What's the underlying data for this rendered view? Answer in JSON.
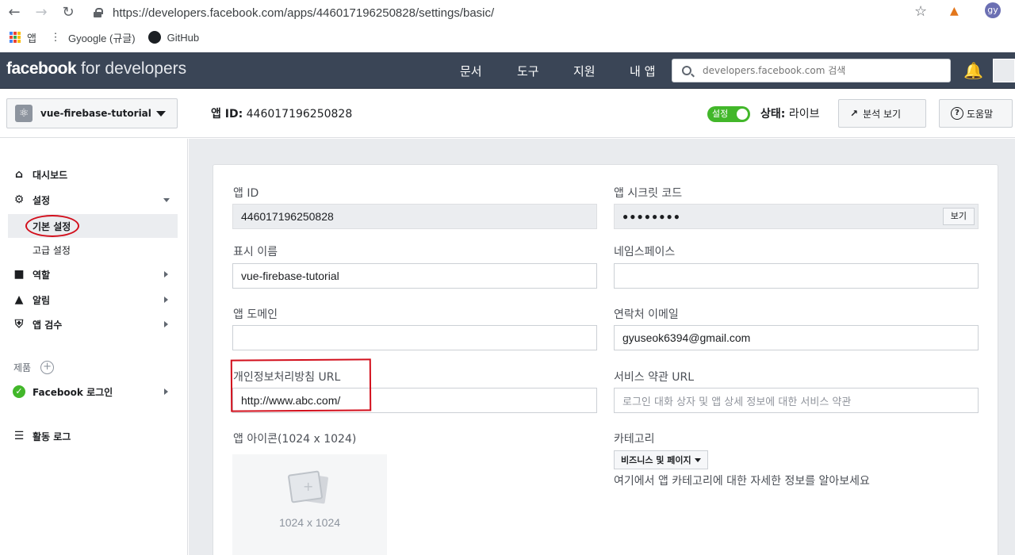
{
  "browser": {
    "url": "https://developers.facebook.com/apps/446017196250828/settings/basic/",
    "bookmarks": [
      {
        "label": "앱"
      },
      {
        "label": "Gyoogle (규글)"
      },
      {
        "label": "GitHub"
      }
    ],
    "profile_initials": "gy"
  },
  "topbar": {
    "logo_bold": "facebook",
    "logo_light": "for developers",
    "nav": [
      "문서",
      "도구",
      "지원",
      "내 앱"
    ],
    "search_placeholder": "developers.facebook.com 검색"
  },
  "app_header": {
    "app_name": "vue-firebase-tutorial",
    "app_id_label": "앱 ID:",
    "app_id_value": "446017196250828",
    "toggle_label": "설정",
    "status_label": "상태:",
    "status_value": "라이브",
    "analytics_button": "분석 보기",
    "help_button": "도움말"
  },
  "sidebar": {
    "dashboard": "대시보드",
    "settings": "설정",
    "basic_settings": "기본 설정",
    "advanced_settings": "고급 설정",
    "roles": "역할",
    "alerts": "알림",
    "app_review": "앱 검수",
    "products_label": "제품",
    "facebook_login": "Facebook 로그인",
    "activity_log": "활동 로그"
  },
  "form": {
    "app_id_label": "앱 ID",
    "app_id_value": "446017196250828",
    "app_secret_label": "앱 시크릿 코드",
    "app_secret_value": "●●●●●●●●",
    "show_button": "보기",
    "display_name_label": "표시 이름",
    "display_name_value": "vue-firebase-tutorial",
    "namespace_label": "네임스페이스",
    "namespace_value": "",
    "app_domain_label": "앱 도메인",
    "app_domain_value": "",
    "contact_email_label": "연락처 이메일",
    "contact_email_value": "gyuseok6394@gmail.com",
    "privacy_url_label": "개인정보처리방침 URL",
    "privacy_url_value": "http://www.abc.com/",
    "tos_url_label": "서비스 약관 URL",
    "tos_url_placeholder": "로그인 대화 상자 및 앱 상세 정보에 대한 서비스 약관",
    "app_icon_label": "앱 아이콘(1024 x 1024)",
    "app_icon_size": "1024 x 1024",
    "category_label": "카테고리",
    "category_value": "비즈니스 및 페이지",
    "category_desc": "여기에서 앱 카테고리에 대한 자세한 정보를 알아보세요"
  },
  "colors": {
    "topbar_bg": "#3a4556",
    "toggle_green": "#42b72a",
    "annotation_red": "#d20f1c"
  }
}
